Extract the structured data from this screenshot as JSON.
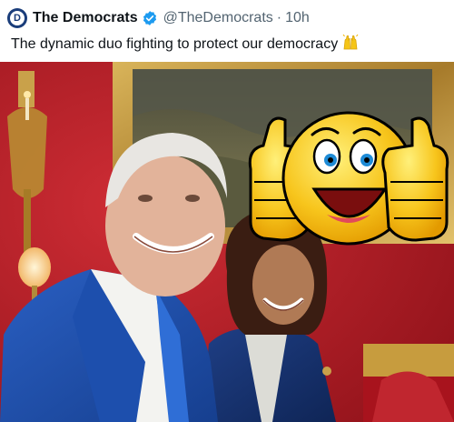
{
  "tweet": {
    "author": {
      "display_name": "The Democrats",
      "handle": "@TheDemocrats",
      "avatar_letter": "D",
      "verified": true
    },
    "separator": "·",
    "timestamp": "10h",
    "text": "The dynamic duo fighting to protect our democracy",
    "text_emoji": "raised-hands-icon",
    "media": {
      "overlay_emoji": "thumbs-up-smiley-icon"
    }
  },
  "colors": {
    "brand_blue": "#1a3d7a",
    "verified_blue": "#1d9bf0",
    "text_primary": "#0f1419",
    "text_secondary": "#536471",
    "wall_red": "#b8202a",
    "emoji_yellow": "#f5c518"
  }
}
